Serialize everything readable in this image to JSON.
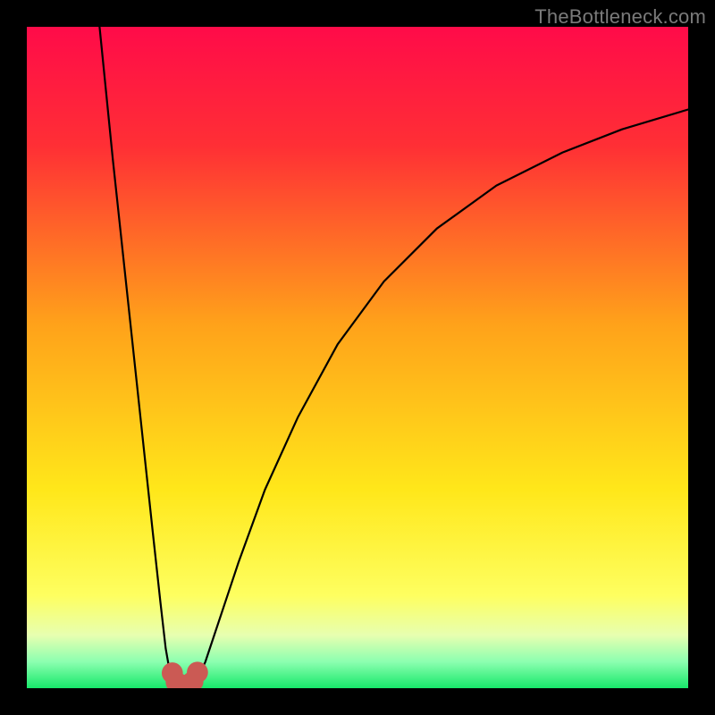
{
  "watermark": "TheBottleneck.com",
  "chart_data": {
    "type": "line",
    "title": "",
    "xlabel": "",
    "ylabel": "",
    "xlim": [
      0,
      100
    ],
    "ylim": [
      0,
      100
    ],
    "grid": false,
    "legend": false,
    "gradient_stops": [
      {
        "offset": 0,
        "color": "#ff0b49"
      },
      {
        "offset": 18,
        "color": "#ff2f35"
      },
      {
        "offset": 45,
        "color": "#ffa21a"
      },
      {
        "offset": 70,
        "color": "#ffe71a"
      },
      {
        "offset": 86,
        "color": "#feff60"
      },
      {
        "offset": 92,
        "color": "#e7ffb0"
      },
      {
        "offset": 96,
        "color": "#8cffb0"
      },
      {
        "offset": 100,
        "color": "#17e86a"
      }
    ],
    "series": [
      {
        "name": "left-branch",
        "x": [
          11.0,
          12.0,
          13.0,
          14.5,
          16.0,
          17.5,
          19.0,
          20.2,
          21.0,
          21.7,
          22.3
        ],
        "y": [
          100.0,
          90.0,
          80.0,
          66.0,
          52.0,
          38.0,
          24.0,
          13.0,
          6.0,
          2.0,
          0.5
        ]
      },
      {
        "name": "valley",
        "x": [
          22.3,
          22.7,
          23.2,
          23.8,
          24.4,
          25.0,
          25.5
        ],
        "y": [
          0.5,
          0.2,
          0.1,
          0.1,
          0.15,
          0.3,
          0.7
        ]
      },
      {
        "name": "right-branch",
        "x": [
          25.5,
          27.0,
          29.0,
          32.0,
          36.0,
          41.0,
          47.0,
          54.0,
          62.0,
          71.0,
          81.0,
          90.0,
          100.0
        ],
        "y": [
          0.7,
          4.0,
          10.0,
          19.0,
          30.0,
          41.0,
          52.0,
          61.5,
          69.5,
          76.0,
          81.0,
          84.5,
          87.5
        ]
      }
    ],
    "markers": {
      "name": "valley-markers",
      "color": "#cb5a54",
      "radius": 1.6,
      "points": [
        {
          "x": 22.0,
          "y": 2.3
        },
        {
          "x": 22.6,
          "y": 0.9
        },
        {
          "x": 23.4,
          "y": 0.5
        },
        {
          "x": 24.3,
          "y": 0.5
        },
        {
          "x": 25.1,
          "y": 1.0
        },
        {
          "x": 25.8,
          "y": 2.4
        }
      ]
    }
  }
}
